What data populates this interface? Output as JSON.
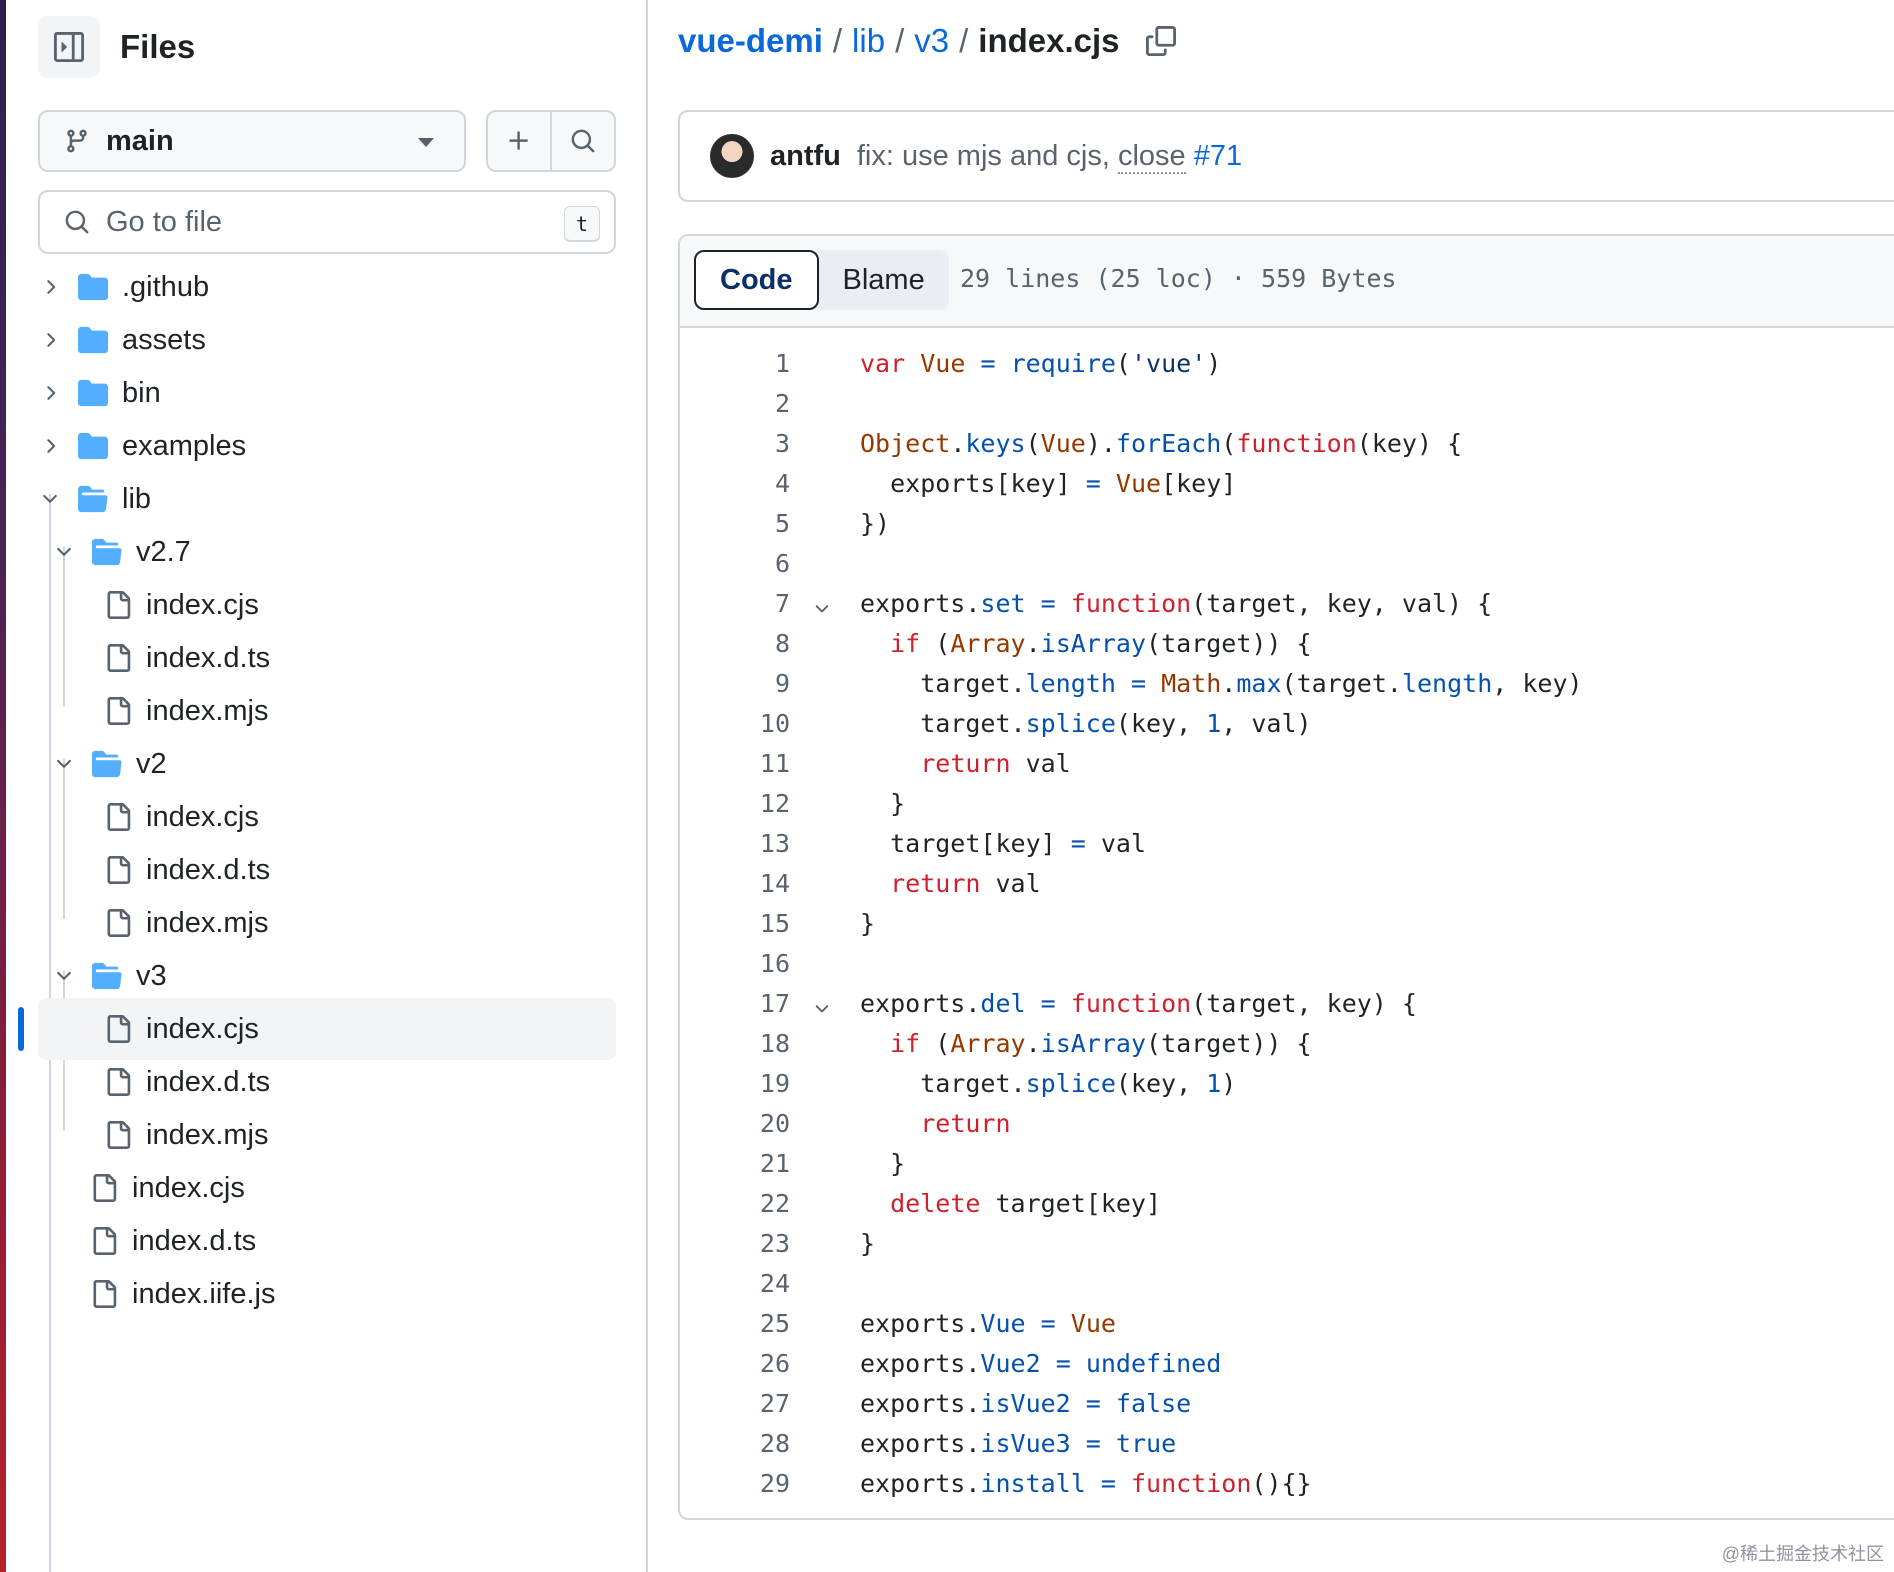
{
  "sidebar": {
    "title": "Files",
    "branch": "main",
    "goto_placeholder": "Go to file",
    "goto_shortcut": "t",
    "tree": [
      {
        "name": ".github",
        "type": "folder",
        "depth": 0,
        "expanded": false
      },
      {
        "name": "assets",
        "type": "folder",
        "depth": 0,
        "expanded": false
      },
      {
        "name": "bin",
        "type": "folder",
        "depth": 0,
        "expanded": false
      },
      {
        "name": "examples",
        "type": "folder",
        "depth": 0,
        "expanded": false
      },
      {
        "name": "lib",
        "type": "folder",
        "depth": 0,
        "expanded": true
      },
      {
        "name": "v2.7",
        "type": "folder",
        "depth": 1,
        "expanded": true
      },
      {
        "name": "index.cjs",
        "type": "file",
        "depth": 2
      },
      {
        "name": "index.d.ts",
        "type": "file",
        "depth": 2
      },
      {
        "name": "index.mjs",
        "type": "file",
        "depth": 2
      },
      {
        "name": "v2",
        "type": "folder",
        "depth": 1,
        "expanded": true
      },
      {
        "name": "index.cjs",
        "type": "file",
        "depth": 2
      },
      {
        "name": "index.d.ts",
        "type": "file",
        "depth": 2
      },
      {
        "name": "index.mjs",
        "type": "file",
        "depth": 2
      },
      {
        "name": "v3",
        "type": "folder",
        "depth": 1,
        "expanded": true
      },
      {
        "name": "index.cjs",
        "type": "file",
        "depth": 2,
        "active": true
      },
      {
        "name": "index.d.ts",
        "type": "file",
        "depth": 2
      },
      {
        "name": "index.mjs",
        "type": "file",
        "depth": 2
      },
      {
        "name": "index.cjs",
        "type": "file",
        "depth": 1
      },
      {
        "name": "index.d.ts",
        "type": "file",
        "depth": 1
      },
      {
        "name": "index.iife.js",
        "type": "file",
        "depth": 1
      }
    ]
  },
  "breadcrumb": {
    "parts": [
      "vue-demi",
      "lib",
      "v3"
    ],
    "separator": "/",
    "current": "index.cjs"
  },
  "commit": {
    "author": "antfu",
    "message": "fix: use mjs and cjs,",
    "close_word": "close",
    "pr": "#71"
  },
  "code_view": {
    "tabs": {
      "code": "Code",
      "blame": "Blame"
    },
    "file_info": "29 lines (25 loc) · 559 Bytes",
    "foldable_lines": [
      7,
      17
    ]
  },
  "code_lines": [
    [
      [
        "k",
        "var"
      ],
      [
        "t",
        " "
      ],
      [
        "o",
        "Vue"
      ],
      [
        "t",
        " "
      ],
      [
        "p",
        "="
      ],
      [
        "t",
        " "
      ],
      [
        "p",
        "require"
      ],
      [
        "t",
        "("
      ],
      [
        "s",
        "'vue'"
      ],
      [
        "t",
        ")"
      ]
    ],
    [],
    [
      [
        "o",
        "Object"
      ],
      [
        "t",
        "."
      ],
      [
        "p",
        "keys"
      ],
      [
        "t",
        "("
      ],
      [
        "o",
        "Vue"
      ],
      [
        "t",
        ")."
      ],
      [
        "p",
        "forEach"
      ],
      [
        "t",
        "("
      ],
      [
        "k",
        "function"
      ],
      [
        "t",
        "(key) {"
      ]
    ],
    [
      [
        "t",
        "  exports[key] "
      ],
      [
        "p",
        "="
      ],
      [
        "t",
        " "
      ],
      [
        "o",
        "Vue"
      ],
      [
        "t",
        "[key]"
      ]
    ],
    [
      [
        "t",
        "})"
      ]
    ],
    [],
    [
      [
        "t",
        "exports."
      ],
      [
        "p",
        "set"
      ],
      [
        "t",
        " "
      ],
      [
        "p",
        "="
      ],
      [
        "t",
        " "
      ],
      [
        "k",
        "function"
      ],
      [
        "t",
        "(target, key, val) {"
      ]
    ],
    [
      [
        "t",
        "  "
      ],
      [
        "k",
        "if"
      ],
      [
        "t",
        " ("
      ],
      [
        "o",
        "Array"
      ],
      [
        "t",
        "."
      ],
      [
        "p",
        "isArray"
      ],
      [
        "t",
        "(target)) {"
      ]
    ],
    [
      [
        "t",
        "    target."
      ],
      [
        "p",
        "length"
      ],
      [
        "t",
        " "
      ],
      [
        "p",
        "="
      ],
      [
        "t",
        " "
      ],
      [
        "o",
        "Math"
      ],
      [
        "t",
        "."
      ],
      [
        "p",
        "max"
      ],
      [
        "t",
        "(target."
      ],
      [
        "p",
        "length"
      ],
      [
        "t",
        ", key)"
      ]
    ],
    [
      [
        "t",
        "    target."
      ],
      [
        "p",
        "splice"
      ],
      [
        "t",
        "(key, "
      ],
      [
        "p",
        "1"
      ],
      [
        "t",
        ", val)"
      ]
    ],
    [
      [
        "t",
        "    "
      ],
      [
        "k",
        "return"
      ],
      [
        "t",
        " val"
      ]
    ],
    [
      [
        "t",
        "  }"
      ]
    ],
    [
      [
        "t",
        "  target[key] "
      ],
      [
        "p",
        "="
      ],
      [
        "t",
        " val"
      ]
    ],
    [
      [
        "t",
        "  "
      ],
      [
        "k",
        "return"
      ],
      [
        "t",
        " val"
      ]
    ],
    [
      [
        "t",
        "}"
      ]
    ],
    [],
    [
      [
        "t",
        "exports."
      ],
      [
        "p",
        "del"
      ],
      [
        "t",
        " "
      ],
      [
        "p",
        "="
      ],
      [
        "t",
        " "
      ],
      [
        "k",
        "function"
      ],
      [
        "t",
        "(target, key) {"
      ]
    ],
    [
      [
        "t",
        "  "
      ],
      [
        "k",
        "if"
      ],
      [
        "t",
        " ("
      ],
      [
        "o",
        "Array"
      ],
      [
        "t",
        "."
      ],
      [
        "p",
        "isArray"
      ],
      [
        "t",
        "(target)) {"
      ]
    ],
    [
      [
        "t",
        "    target."
      ],
      [
        "p",
        "splice"
      ],
      [
        "t",
        "(key, "
      ],
      [
        "p",
        "1"
      ],
      [
        "t",
        ")"
      ]
    ],
    [
      [
        "t",
        "    "
      ],
      [
        "k",
        "return"
      ]
    ],
    [
      [
        "t",
        "  }"
      ]
    ],
    [
      [
        "t",
        "  "
      ],
      [
        "k",
        "delete"
      ],
      [
        "t",
        " target[key]"
      ]
    ],
    [
      [
        "t",
        "}"
      ]
    ],
    [],
    [
      [
        "t",
        "exports."
      ],
      [
        "p",
        "Vue"
      ],
      [
        "t",
        " "
      ],
      [
        "p",
        "="
      ],
      [
        "t",
        " "
      ],
      [
        "o",
        "Vue"
      ]
    ],
    [
      [
        "t",
        "exports."
      ],
      [
        "p",
        "Vue2"
      ],
      [
        "t",
        " "
      ],
      [
        "p",
        "="
      ],
      [
        "t",
        " "
      ],
      [
        "p",
        "undefined"
      ]
    ],
    [
      [
        "t",
        "exports."
      ],
      [
        "p",
        "isVue2"
      ],
      [
        "t",
        " "
      ],
      [
        "p",
        "="
      ],
      [
        "t",
        " "
      ],
      [
        "p",
        "false"
      ]
    ],
    [
      [
        "t",
        "exports."
      ],
      [
        "p",
        "isVue3"
      ],
      [
        "t",
        " "
      ],
      [
        "p",
        "="
      ],
      [
        "t",
        " "
      ],
      [
        "p",
        "true"
      ]
    ],
    [
      [
        "t",
        "exports."
      ],
      [
        "p",
        "install"
      ],
      [
        "t",
        " "
      ],
      [
        "p",
        "="
      ],
      [
        "t",
        " "
      ],
      [
        "k",
        "function"
      ],
      [
        "t",
        "(){}"
      ]
    ]
  ],
  "watermark": "@稀土掘金技术社区",
  "colors": {
    "link": "#0969da",
    "keyword": "#cf222e",
    "constant": "#0550ae",
    "entity": "#953800",
    "folder": "#54aeff"
  }
}
